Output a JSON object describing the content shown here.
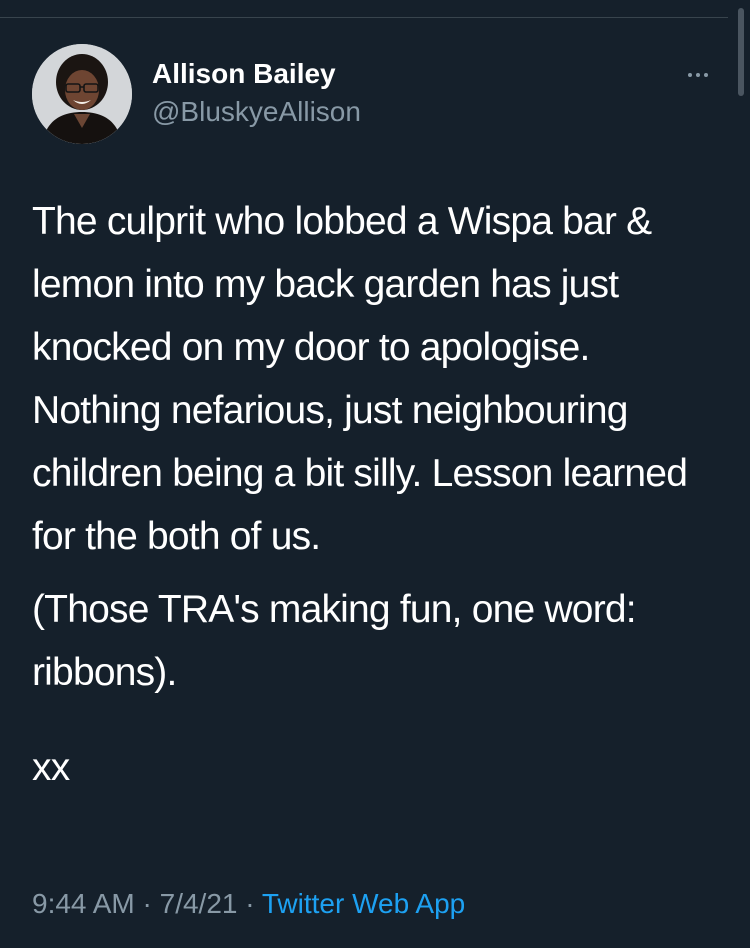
{
  "tweet": {
    "author_name": "Allison Bailey",
    "author_handle": "@BluskyeAllison",
    "paragraphs": [
      "The culprit who lobbed a Wispa bar & lemon into my back garden has just knocked on my door to apologise. Nothing nefarious, just neighbouring children being a bit silly. Lesson learned for the both of us.",
      "(Those TRA's making fun, one word: ribbons).",
      "xx"
    ],
    "time": "9:44 AM",
    "separator": "·",
    "date": "7/4/21",
    "source": "Twitter Web App"
  },
  "icons": {
    "more": "more-horizontal-icon",
    "avatar": "profile-photo"
  },
  "colors": {
    "background": "#15202b",
    "primary_text": "#ffffff",
    "secondary_text": "#8899a6",
    "link": "#1da1f2",
    "divider": "#38444d"
  }
}
